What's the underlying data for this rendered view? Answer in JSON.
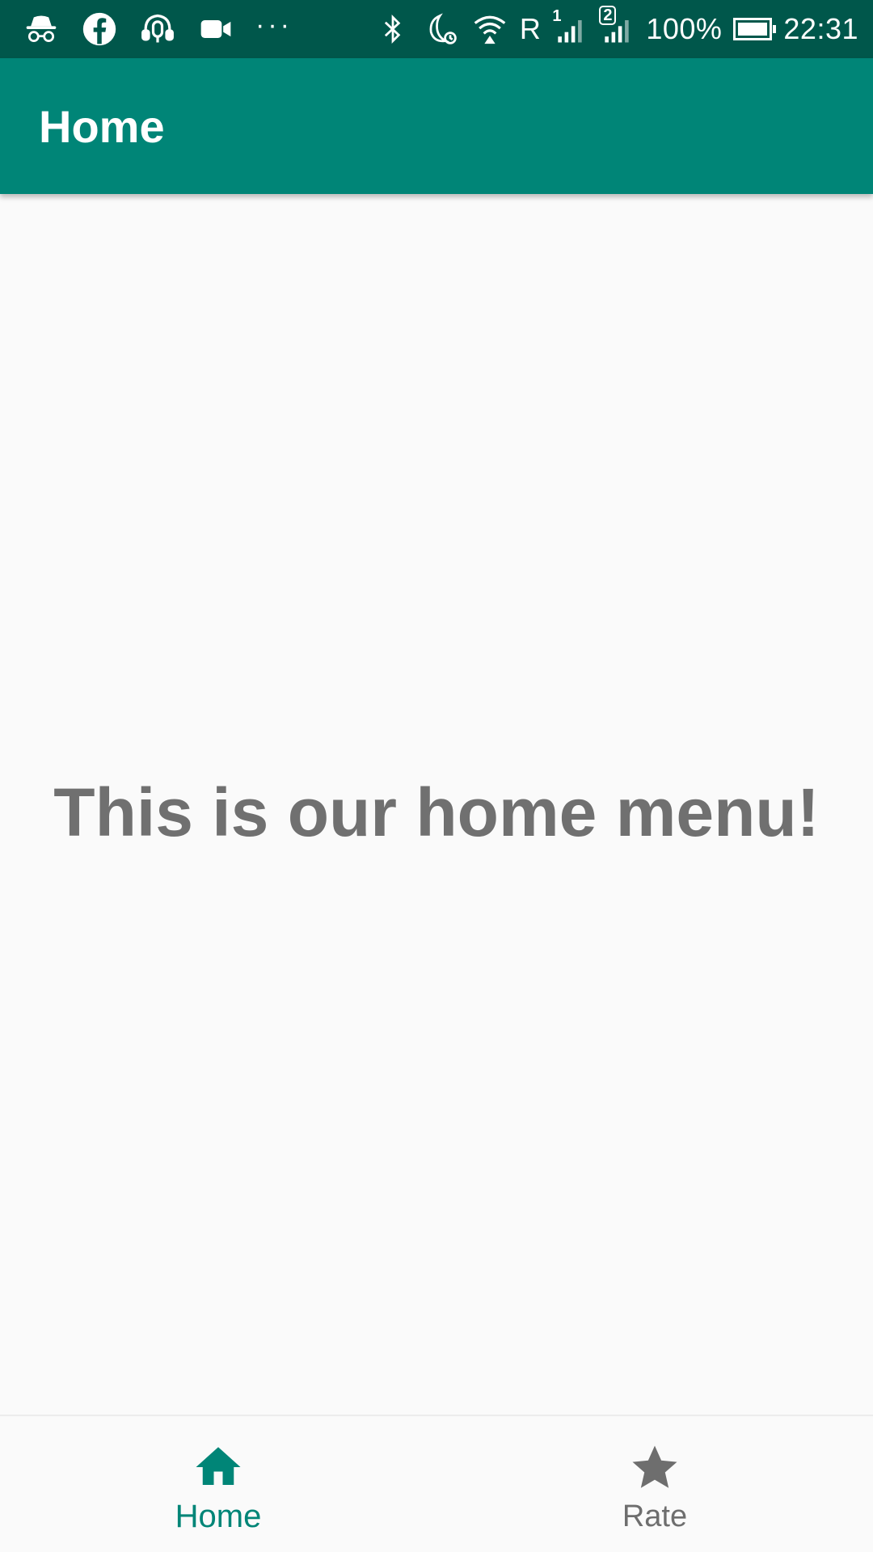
{
  "status_bar": {
    "icons_left": [
      "incognito-icon",
      "facebook-icon",
      "podcast-icon",
      "video-camera-icon"
    ],
    "overflow": "···",
    "icons_right": [
      "bluetooth-icon",
      "do-not-disturb-alarm-icon",
      "wifi-icon"
    ],
    "roaming": "R",
    "sim1_label": "1",
    "sim2_label": "2",
    "battery": "100%",
    "battery_level": 1.0,
    "time": "22:31"
  },
  "app_bar": {
    "title": "Home"
  },
  "main": {
    "message": "This is our home menu!"
  },
  "bottom_nav": {
    "items": [
      {
        "label": "Home",
        "icon": "home-icon",
        "active": true
      },
      {
        "label": "Rate",
        "icon": "star-icon",
        "active": false
      }
    ]
  },
  "colors": {
    "status_bar": "#00574b",
    "primary": "#008577",
    "accent_active": "#008577",
    "inactive": "#6e6e6e",
    "message_text": "#707070",
    "background": "#fafafa"
  }
}
